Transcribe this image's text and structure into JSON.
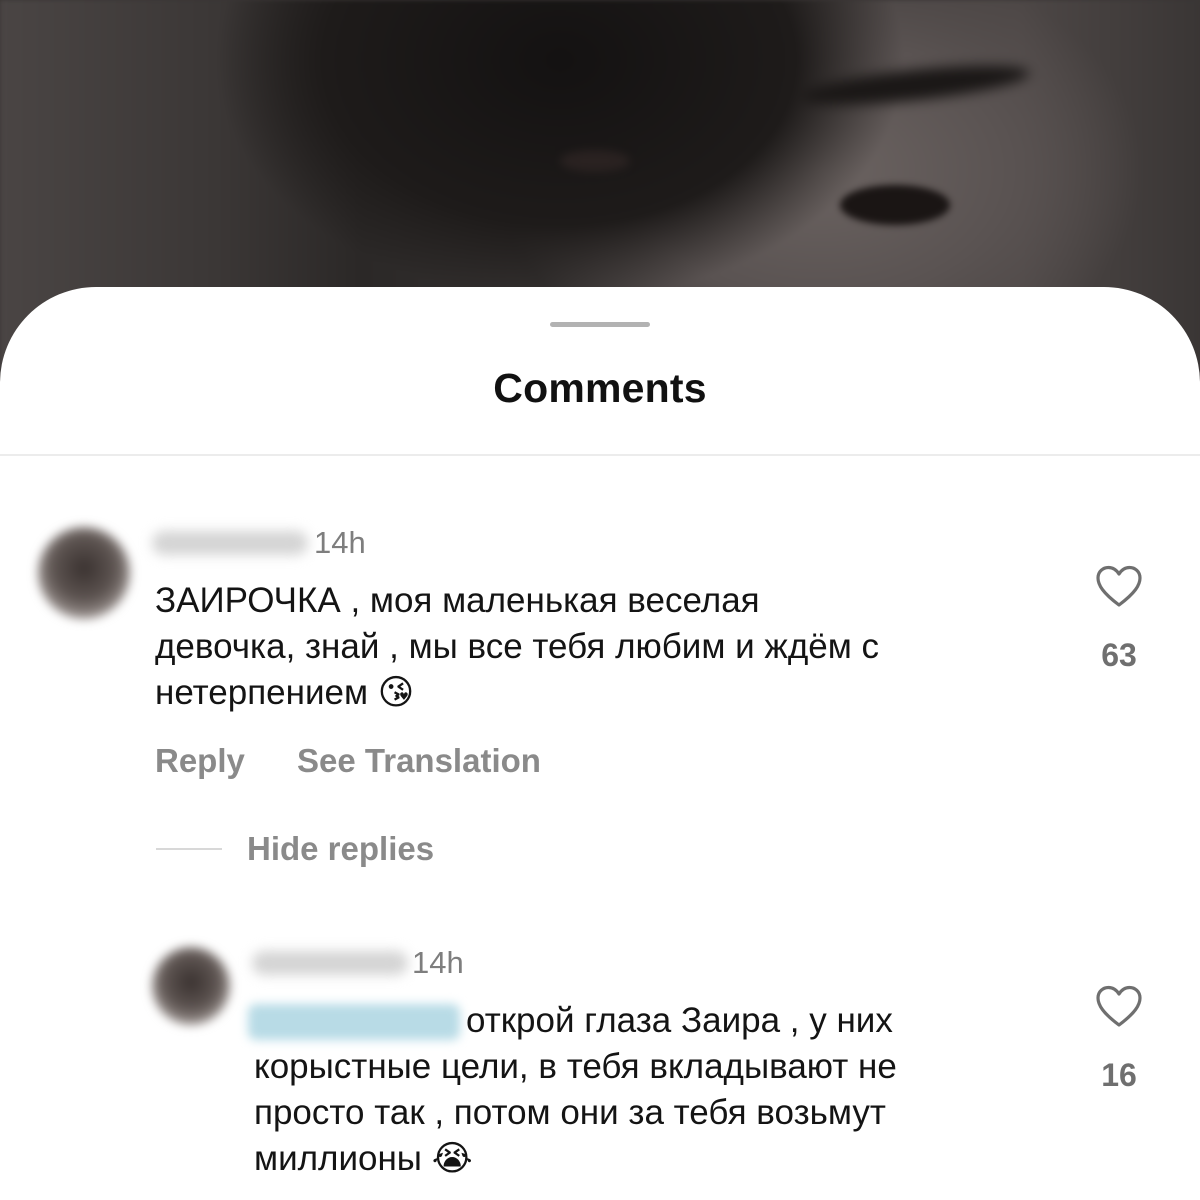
{
  "sheet": {
    "title": "Comments"
  },
  "comments": [
    {
      "time": "14h",
      "text_lines": [
        "ЗАИРОЧКА , моя маленькая веселая",
        "девочка, знай , мы все тебя любим и ждём с",
        "нетерпением"
      ],
      "emoji": "😘",
      "likes": "63",
      "reply_label": "Reply",
      "translation_label": "See Translation",
      "hide_replies_label": "Hide replies"
    },
    {
      "time": "14h",
      "text_lines": [
        "открой глаза Заира , у них",
        "корыстные цели, в тебя вкладывают не",
        "просто так , потом они за тебя возьмут",
        "миллионы"
      ],
      "emoji": "😭",
      "likes": "16"
    }
  ],
  "icons": {
    "like": "heart-outline-icon"
  },
  "colors": {
    "sheet_background": "#ffffff",
    "muted_text": "#8a8a8a",
    "primary_text": "#141414"
  }
}
